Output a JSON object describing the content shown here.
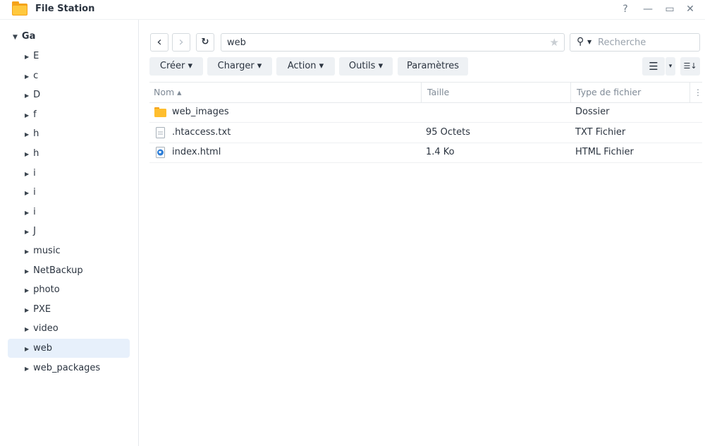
{
  "window": {
    "title": "File Station",
    "controls": {
      "help": "?",
      "minimize": "—",
      "maximize": "▭",
      "close": "✕"
    }
  },
  "sidebar": {
    "root_label": "Ga",
    "items": [
      {
        "label": "E"
      },
      {
        "label": "c"
      },
      {
        "label": "D"
      },
      {
        "label": "f"
      },
      {
        "label": "h"
      },
      {
        "label": "h"
      },
      {
        "label": "i"
      },
      {
        "label": "i"
      },
      {
        "label": "i"
      },
      {
        "label": "J"
      },
      {
        "label": "music"
      },
      {
        "label": "NetBackup"
      },
      {
        "label": "photo"
      },
      {
        "label": "PXE"
      },
      {
        "label": "video"
      },
      {
        "label": "web",
        "selected": true
      },
      {
        "label": "web_packages"
      }
    ]
  },
  "toolbar": {
    "back": "‹",
    "forward": "›",
    "refresh": "↻",
    "path_value": "web",
    "search_placeholder": "Recherche",
    "create_label": "Créer ▾",
    "upload_label": "Charger ▾",
    "action_label": "Action ▾",
    "tools_label": "Outils ▾",
    "settings_label": "Paramètres",
    "list_view": "☰",
    "view_dropdown": "▾",
    "sort": "☰↓"
  },
  "table": {
    "columns": [
      "Nom ▴",
      "Taille",
      "Type de fichier"
    ],
    "rows": [
      {
        "name": "web_images",
        "size": "",
        "type": "Dossier",
        "icon": "folder-icon"
      },
      {
        "name": ".htaccess.txt",
        "size": "95 Octets",
        "type": "TXT Fichier",
        "icon": "text-file-icon"
      },
      {
        "name": "index.html",
        "size": "1.4 Ko",
        "type": "HTML Fichier",
        "icon": "html-file-icon"
      }
    ]
  },
  "colors": {
    "accent": "#1b6ec2",
    "selected_bg": "#e7f0fb",
    "button_bg": "#eef1f4",
    "folder": "#f7b51b"
  }
}
